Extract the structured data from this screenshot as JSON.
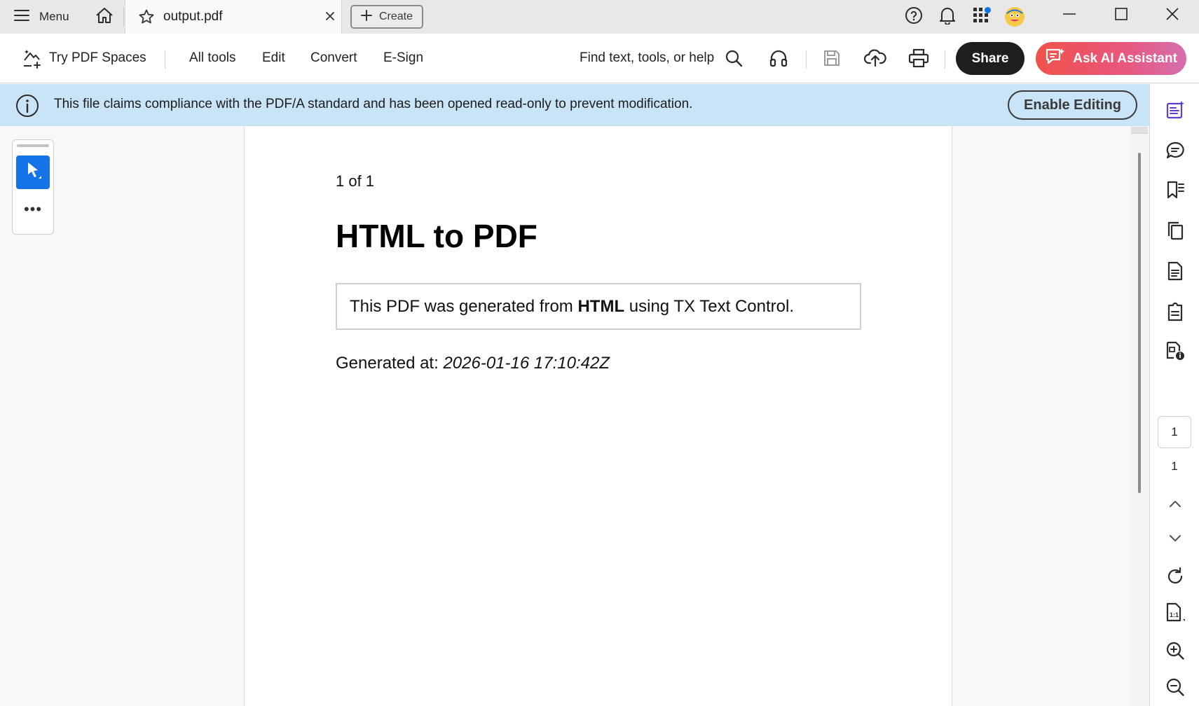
{
  "titlebar": {
    "menu_label": "Menu",
    "tab_title": "output.pdf",
    "create_label": "Create",
    "icons": [
      "menu-icon",
      "home-icon",
      "star-icon",
      "close-icon",
      "plus-icon",
      "help-icon",
      "bell-icon",
      "apps-icon",
      "avatar",
      "minimize-icon",
      "maximize-icon",
      "window-close-icon"
    ]
  },
  "toolbar": {
    "try_spaces": "Try PDF Spaces",
    "nav": [
      "All tools",
      "Edit",
      "Convert",
      "E-Sign"
    ],
    "search_label": "Find text, tools, or help",
    "share_label": "Share",
    "ai_label": "Ask AI Assistant"
  },
  "banner": {
    "message": "This file claims compliance with the PDF/A standard and has been opened read-only to prevent modification.",
    "enable_label": "Enable Editing"
  },
  "document": {
    "page_counter": "1 of 1",
    "heading": "HTML to PDF",
    "box_text_before": "This PDF was generated from ",
    "box_text_bold": "HTML",
    "box_text_after": " using TX Text Control.",
    "generated_label": "Generated at: ",
    "generated_value": "2026-01-16 17:10:42Z"
  },
  "rail": {
    "current_page": "1",
    "total_pages": "1"
  },
  "colors": {
    "accent_blue": "#1473e6",
    "banner_bg": "#c9e3f7",
    "share_bg": "#1e1e1e",
    "ai_gradient_start": "#f0524b",
    "ai_gradient_end": "#d56fae",
    "rail_active_icon": "#5b3fd0"
  }
}
